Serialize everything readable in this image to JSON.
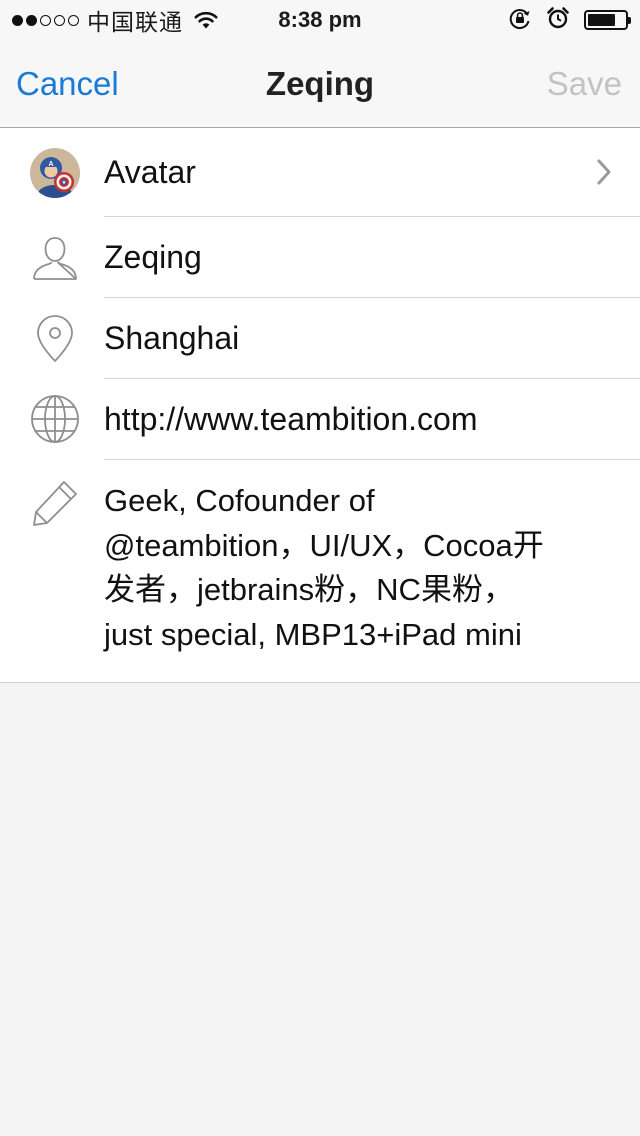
{
  "status_bar": {
    "carrier": "中国联通",
    "time": "8:38 pm",
    "signal_filled": 2,
    "signal_total": 5,
    "battery_level": 0.75
  },
  "nav": {
    "cancel_label": "Cancel",
    "title": "Zeqing",
    "save_label": "Save",
    "accent_color": "#1a7ad6",
    "disabled_color": "#c3c3c3"
  },
  "profile": {
    "avatar_label": "Avatar",
    "name": "Zeqing",
    "location": "Shanghai",
    "website": "http://www.teambition.com",
    "bio": "Geek, Cofounder of\n@teambition，UI/UX，Cocoa开\n发者，jetbrains粉，NC果粉，\njust special, MBP13+iPad mini"
  },
  "icons": {
    "avatar": "avatar-image",
    "name": "person-icon",
    "location": "location-pin-icon",
    "website": "globe-icon",
    "bio": "pencil-icon",
    "disclosure": "chevron-right-icon"
  }
}
